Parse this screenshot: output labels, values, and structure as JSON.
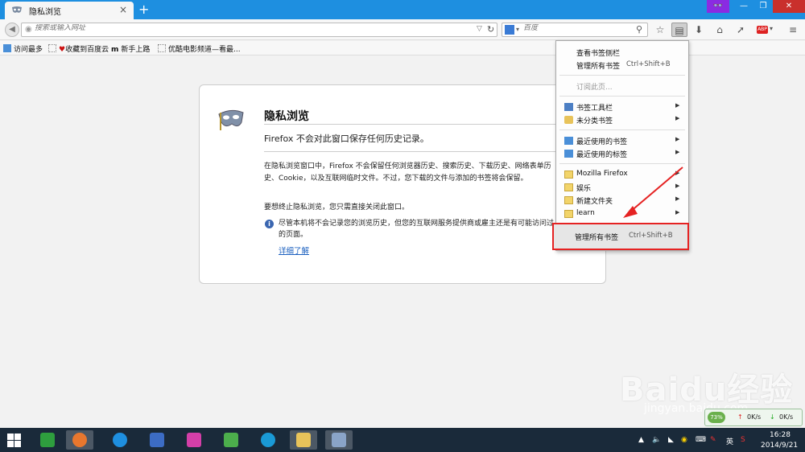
{
  "window": {
    "tab_title": "隐私浏览",
    "tab_close": "×",
    "new_tab": "+",
    "minimize": "—",
    "maximize": "❐",
    "close": "✕",
    "private_badge": "👓"
  },
  "navbar": {
    "url_placeholder": "搜索或输入网址",
    "search_placeholder": "百度",
    "search_engine": "百度"
  },
  "bookmarks_bar": {
    "items": [
      {
        "label": "访问最多"
      },
      {
        "label": "收藏到百度云"
      },
      {
        "label": "新手上路"
      },
      {
        "label": "优酷电影频道—看最..."
      }
    ]
  },
  "private_page": {
    "title": "隐私浏览",
    "subtitle": "Firefox 不会对此窗口保存任何历史记录。",
    "paragraph1": "在隐私浏览窗口中，Firefox 不会保留任何浏览器历史、搜索历史、下载历史、网络表单历史、Cookie，以及互联网临时文件。不过，您下载的文件与添加的书签将会保留。",
    "paragraph2": "要想终止隐私浏览，您只需直接关闭此窗口。",
    "notice": "尽管本机将不会记录您的浏览历史，但您的互联网服务提供商或雇主还是有可能访问过的页面。",
    "learn_more": "详细了解"
  },
  "bookmarks_menu": {
    "items": [
      {
        "label": "查看书签侧栏",
        "shortcut": ""
      },
      {
        "label": "管理所有书签",
        "shortcut": "Ctrl+Shift+B"
      },
      {
        "label": "订阅此页...",
        "shortcut": "",
        "disabled": true
      },
      {
        "label": "书签工具栏",
        "submenu": true
      },
      {
        "label": "未分类书签",
        "submenu": true
      },
      {
        "label": "最近使用的书签",
        "submenu": true
      },
      {
        "label": "最近使用的标签",
        "submenu": true
      },
      {
        "label": "Mozilla Firefox",
        "submenu": true
      },
      {
        "label": "娱乐",
        "submenu": true
      },
      {
        "label": "新建文件夹",
        "submenu": true
      },
      {
        "label": "learn",
        "submenu": true
      }
    ],
    "highlighted": {
      "label": "管理所有书签",
      "shortcut": "Ctrl+Shift+B"
    }
  },
  "watermark": {
    "brand": "Baidu经验",
    "url": "jingyan.baidu.com"
  },
  "netmon": {
    "percent": "73%",
    "up_label": "↑",
    "up_speed": "0K/s",
    "down_label": "↓",
    "down_speed": "0K/s"
  },
  "taskbar": {
    "time": "16:28",
    "date": "2014/9/21",
    "ime": "英"
  },
  "colors": {
    "titlebar": "#1e8fe0",
    "highlight_border": "#e52222",
    "arrow": "#e52222",
    "link": "#1a5fbf"
  }
}
